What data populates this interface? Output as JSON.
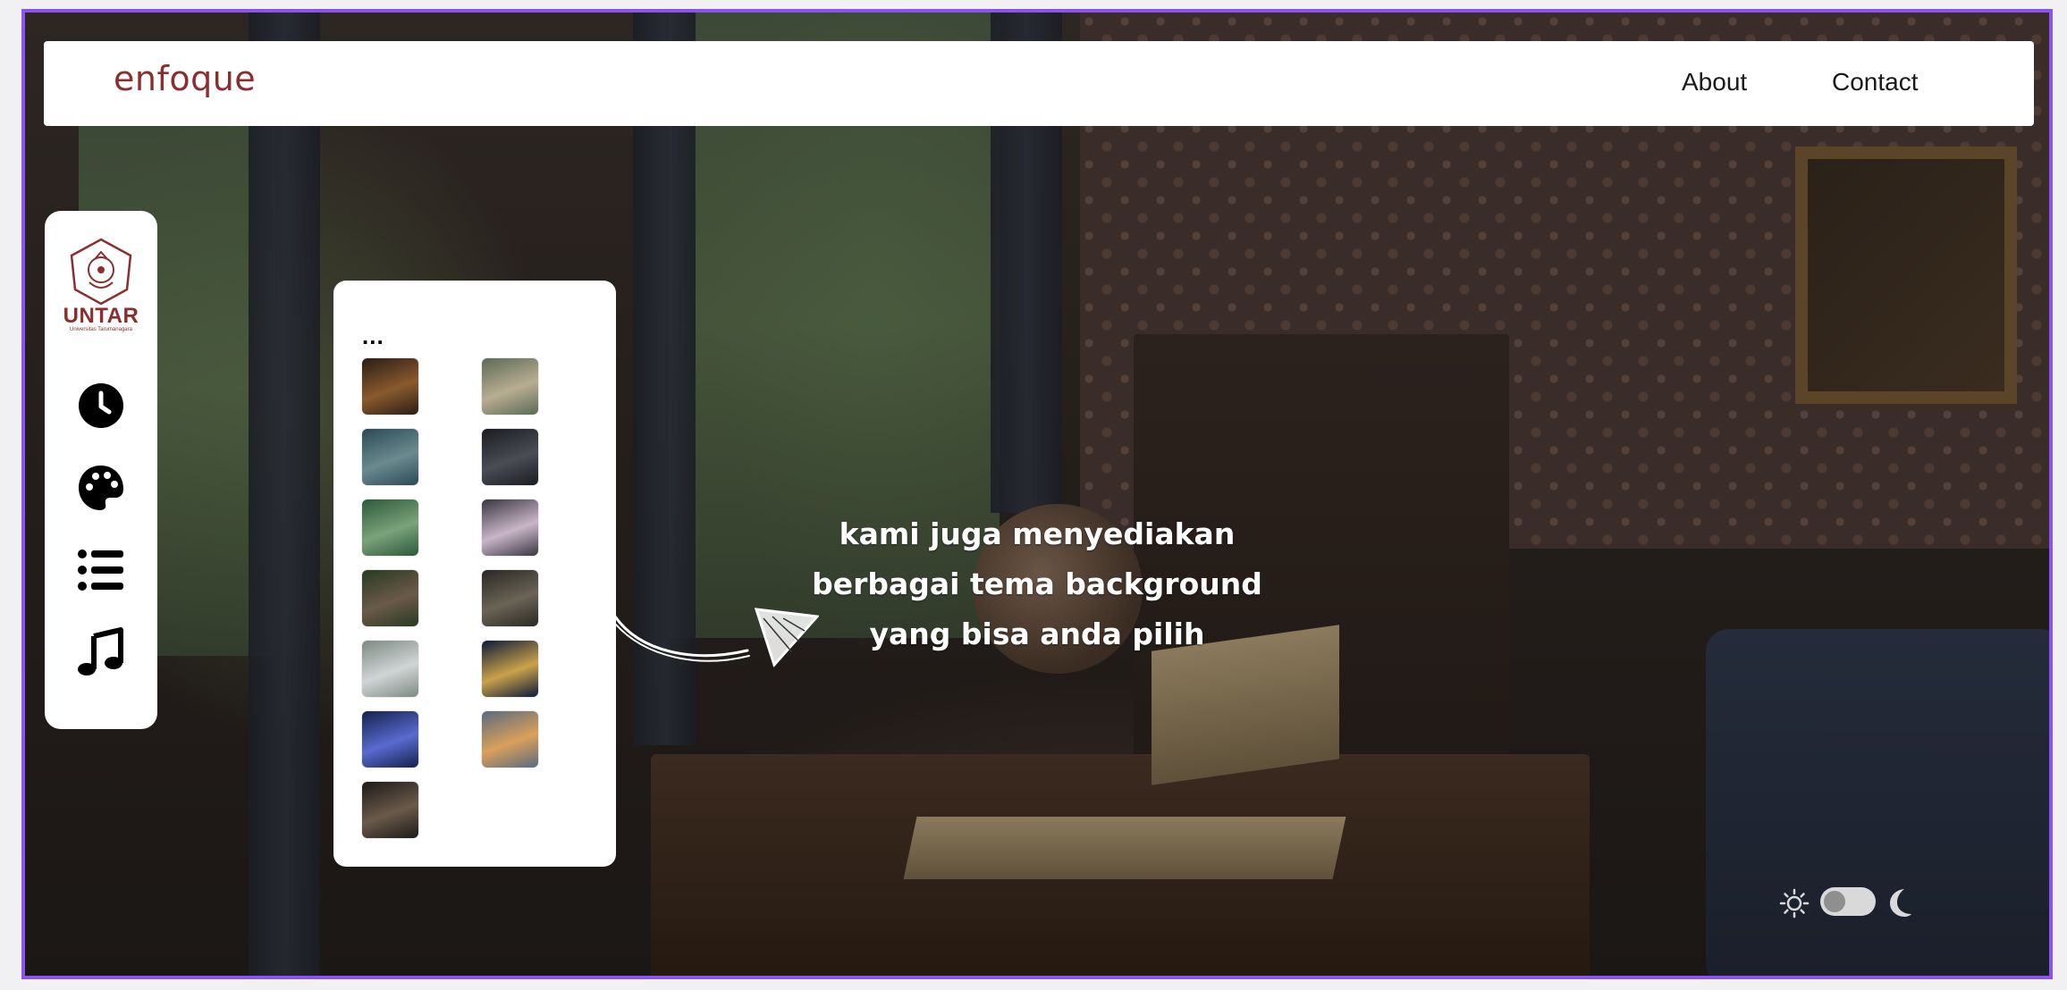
{
  "navbar": {
    "brand": "enfoque",
    "links": [
      "About",
      "Contact"
    ]
  },
  "sidebar": {
    "logo": {
      "name": "UNTAR",
      "subtitle": "Universitas Tarumanagara"
    },
    "icons": [
      "clock-icon",
      "palette-icon",
      "list-icon",
      "music-icon"
    ]
  },
  "theme_panel": {
    "menu_label": "...",
    "thumbnails": [
      {
        "name": "fireplace",
        "colors": [
          "#2a1d16",
          "#8a5a2e"
        ]
      },
      {
        "name": "study-group",
        "colors": [
          "#5c6a55",
          "#b8ad92"
        ]
      },
      {
        "name": "aerial-trees",
        "colors": [
          "#2c4a55",
          "#6b8a8f"
        ]
      },
      {
        "name": "night-city",
        "colors": [
          "#1a1c20",
          "#4a4d55"
        ]
      },
      {
        "name": "river-garden",
        "colors": [
          "#2d5a3a",
          "#7aa27a"
        ]
      },
      {
        "name": "cherry-blossom",
        "colors": [
          "#3a3540",
          "#c9b6c8"
        ]
      },
      {
        "name": "forest-floor",
        "colors": [
          "#2a3a24",
          "#6a5a48"
        ]
      },
      {
        "name": "rainy-window",
        "colors": [
          "#2a2824",
          "#6a6456"
        ]
      },
      {
        "name": "park-city",
        "colors": [
          "#7d8a82",
          "#d0d4d6"
        ]
      },
      {
        "name": "bridge-night",
        "colors": [
          "#0d1a3a",
          "#c9a24a"
        ]
      },
      {
        "name": "skyline-night",
        "colors": [
          "#14224a",
          "#5a6ad0"
        ]
      },
      {
        "name": "sunset-road",
        "colors": [
          "#5a6a80",
          "#d9a05a"
        ]
      },
      {
        "name": "ruins-arch",
        "colors": [
          "#1d1a18",
          "#6a5a4a"
        ]
      }
    ]
  },
  "callout": {
    "lines": [
      "kami juga menyediakan",
      "berbagai tema background",
      "yang bisa anda pilih"
    ]
  },
  "theme_toggle": {
    "light_icon": "sun-icon",
    "dark_icon": "moon-icon",
    "state": "light"
  },
  "colors": {
    "frame_border": "#8a55ee",
    "brand": "#8a2e2e",
    "panel_bg": "#ffffff"
  }
}
